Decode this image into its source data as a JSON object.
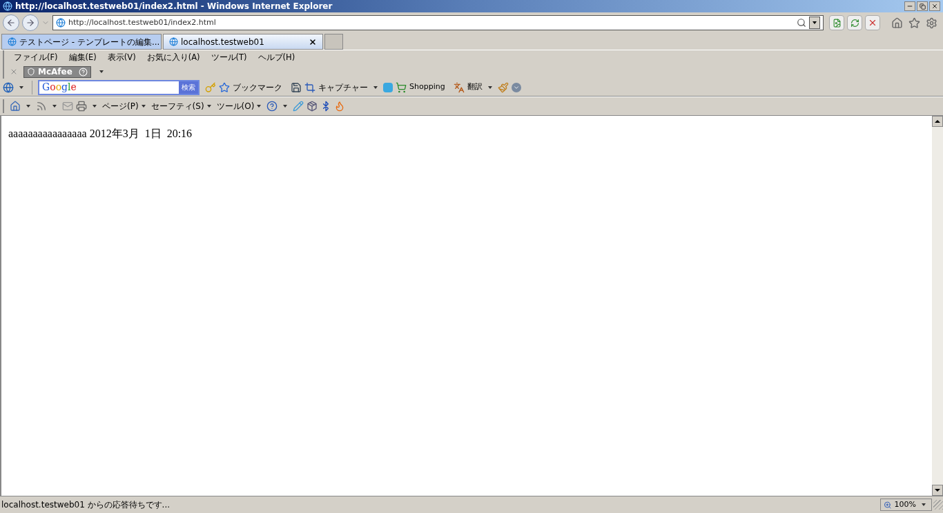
{
  "window": {
    "title": "http://localhost.testweb01/index2.html - Windows Internet Explorer"
  },
  "address_bar": {
    "url": "http://localhost.testweb01/index2.html"
  },
  "tabs": [
    {
      "label": "テストページ - テンプレートの編集...",
      "selected": false
    },
    {
      "label": "localhost.testweb01",
      "selected": true
    }
  ],
  "menu": [
    "ファイル(F)",
    "編集(E)",
    "表示(V)",
    "お気に入り(A)",
    "ツール(T)",
    "ヘルプ(H)"
  ],
  "mcafee": {
    "label": "McAfee"
  },
  "google_toolbar": {
    "logo": "Google",
    "search_button": "検索",
    "bookmark": "ブックマーク",
    "capture": "キャプチャー",
    "shopping": "Shopping",
    "translate": "翻訳"
  },
  "command_bar": {
    "items": [
      "ページ(P)",
      "セーフティ(S)",
      "ツール(O)"
    ]
  },
  "page": {
    "text": "aaaaaaaaaaaaaaaa 2012年3月  1日  20:16"
  },
  "status_bar": {
    "text": "localhost.testweb01 からの応答待ちです...",
    "zoom": "100%"
  }
}
